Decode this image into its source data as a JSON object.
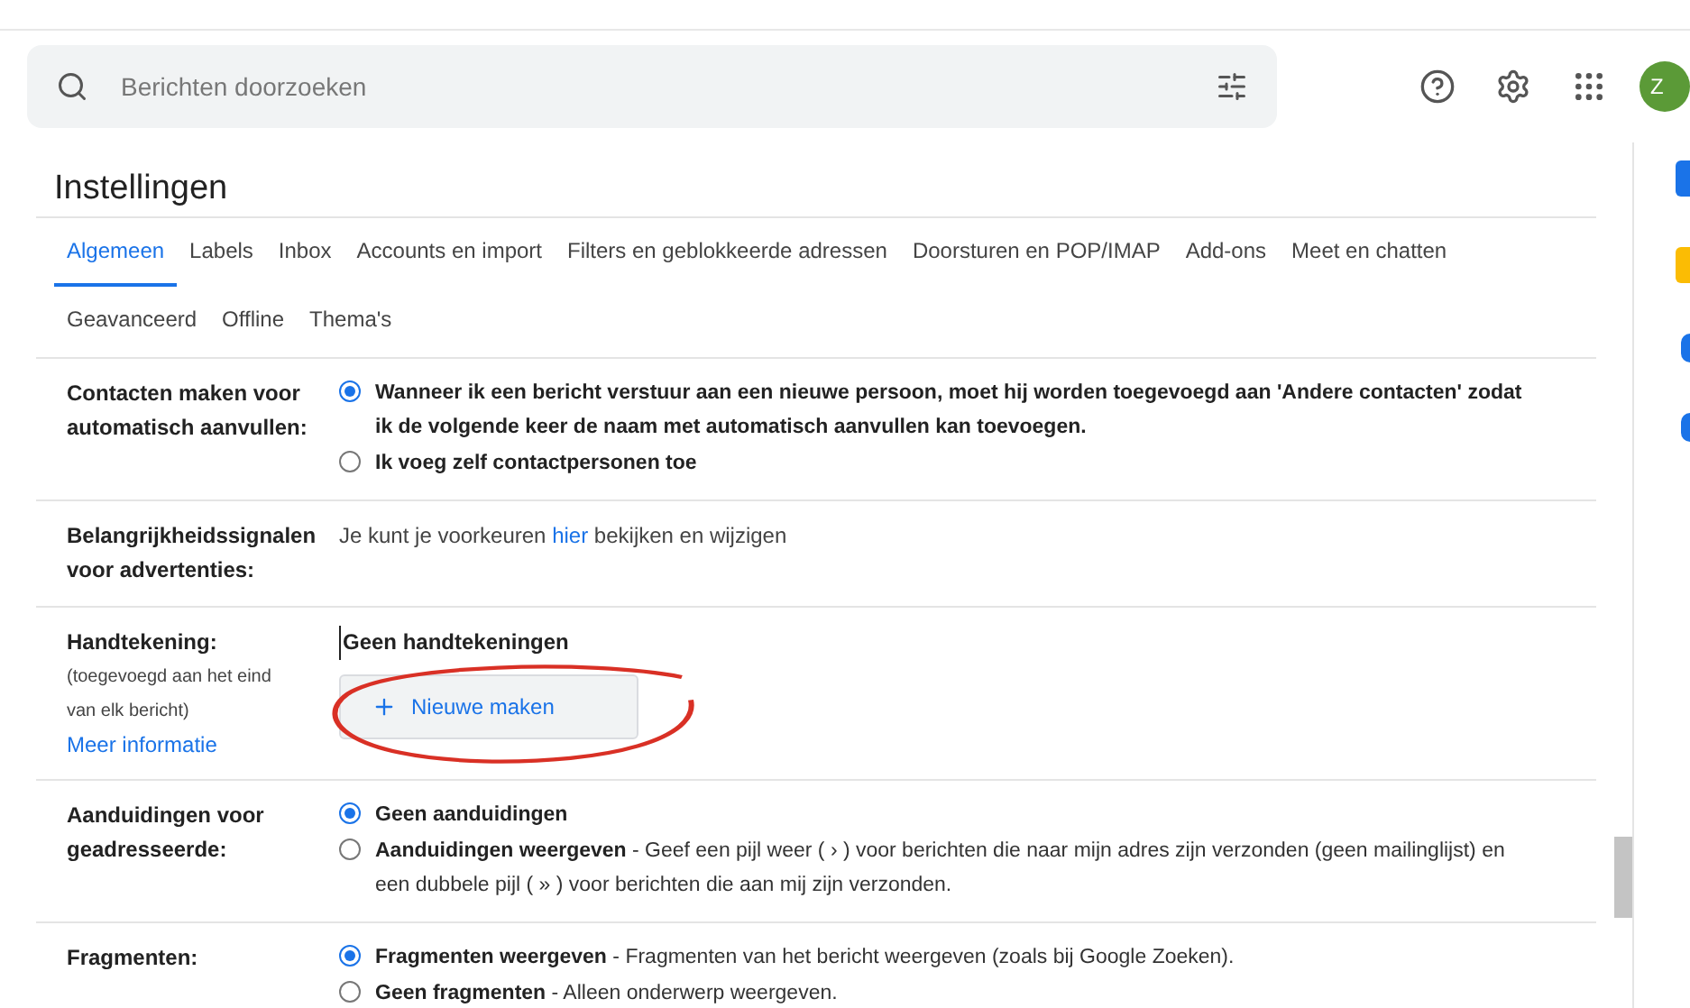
{
  "search": {
    "placeholder": "Berichten doorzoeken"
  },
  "avatar": {
    "letter": "Z"
  },
  "title": "Instellingen",
  "tabs": [
    {
      "label": "Algemeen",
      "selected": true
    },
    {
      "label": "Labels",
      "selected": false
    },
    {
      "label": "Inbox",
      "selected": false
    },
    {
      "label": "Accounts en import",
      "selected": false
    },
    {
      "label": "Filters en geblokkeerde adressen",
      "selected": false
    },
    {
      "label": "Doorsturen en POP/IMAP",
      "selected": false
    },
    {
      "label": "Add-ons",
      "selected": false
    },
    {
      "label": "Meet en chatten",
      "selected": false
    },
    {
      "label": "Geavanceerd",
      "selected": false
    },
    {
      "label": "Offline",
      "selected": false
    },
    {
      "label": "Thema's",
      "selected": false
    }
  ],
  "settings": [
    {
      "kind": "radio",
      "label": "Contacten maken voor automatisch aanvullen:",
      "options": [
        {
          "selected": true,
          "title": "Wanneer ik een bericht verstuur aan een nieuwe persoon, moet hij worden toegevoegd aan 'Andere contacten' zodat ik de volgende keer de naam met automatisch aanvullen kan toevoegen."
        },
        {
          "selected": false,
          "title": "Ik voeg zelf contactpersonen toe"
        }
      ]
    },
    {
      "kind": "text",
      "label": "Belangrijkheidssignalen voor advertenties:",
      "before": "Je kunt je voorkeuren ",
      "link": "hier",
      "after": " bekijken en wijzigen"
    },
    {
      "kind": "signature",
      "label": "Handtekening:",
      "note": "(toegevoegd aan het eind van elk bericht)",
      "link": "Meer informatie",
      "status": "Geen handtekeningen",
      "button": "Nieuwe maken"
    },
    {
      "kind": "radio",
      "label": "Aanduidingen voor geadresseerde:",
      "options": [
        {
          "selected": true,
          "title": "Geen aanduidingen"
        },
        {
          "selected": false,
          "title": "Aanduidingen weergeven",
          "description": " - Geef een pijl weer ( › ) voor berichten die naar mijn adres zijn verzonden (geen mailinglijst) en een dubbele pijl ( » ) voor berichten die aan mij zijn verzonden."
        }
      ]
    },
    {
      "kind": "radio",
      "label": "Fragmenten:",
      "options": [
        {
          "selected": true,
          "title": "Fragmenten weergeven",
          "description": " - Fragmenten van het bericht weergeven (zoals bij Google Zoeken)."
        },
        {
          "selected": false,
          "title": "Geen fragmenten",
          "description": " - Alleen onderwerp weergeven."
        }
      ]
    }
  ]
}
